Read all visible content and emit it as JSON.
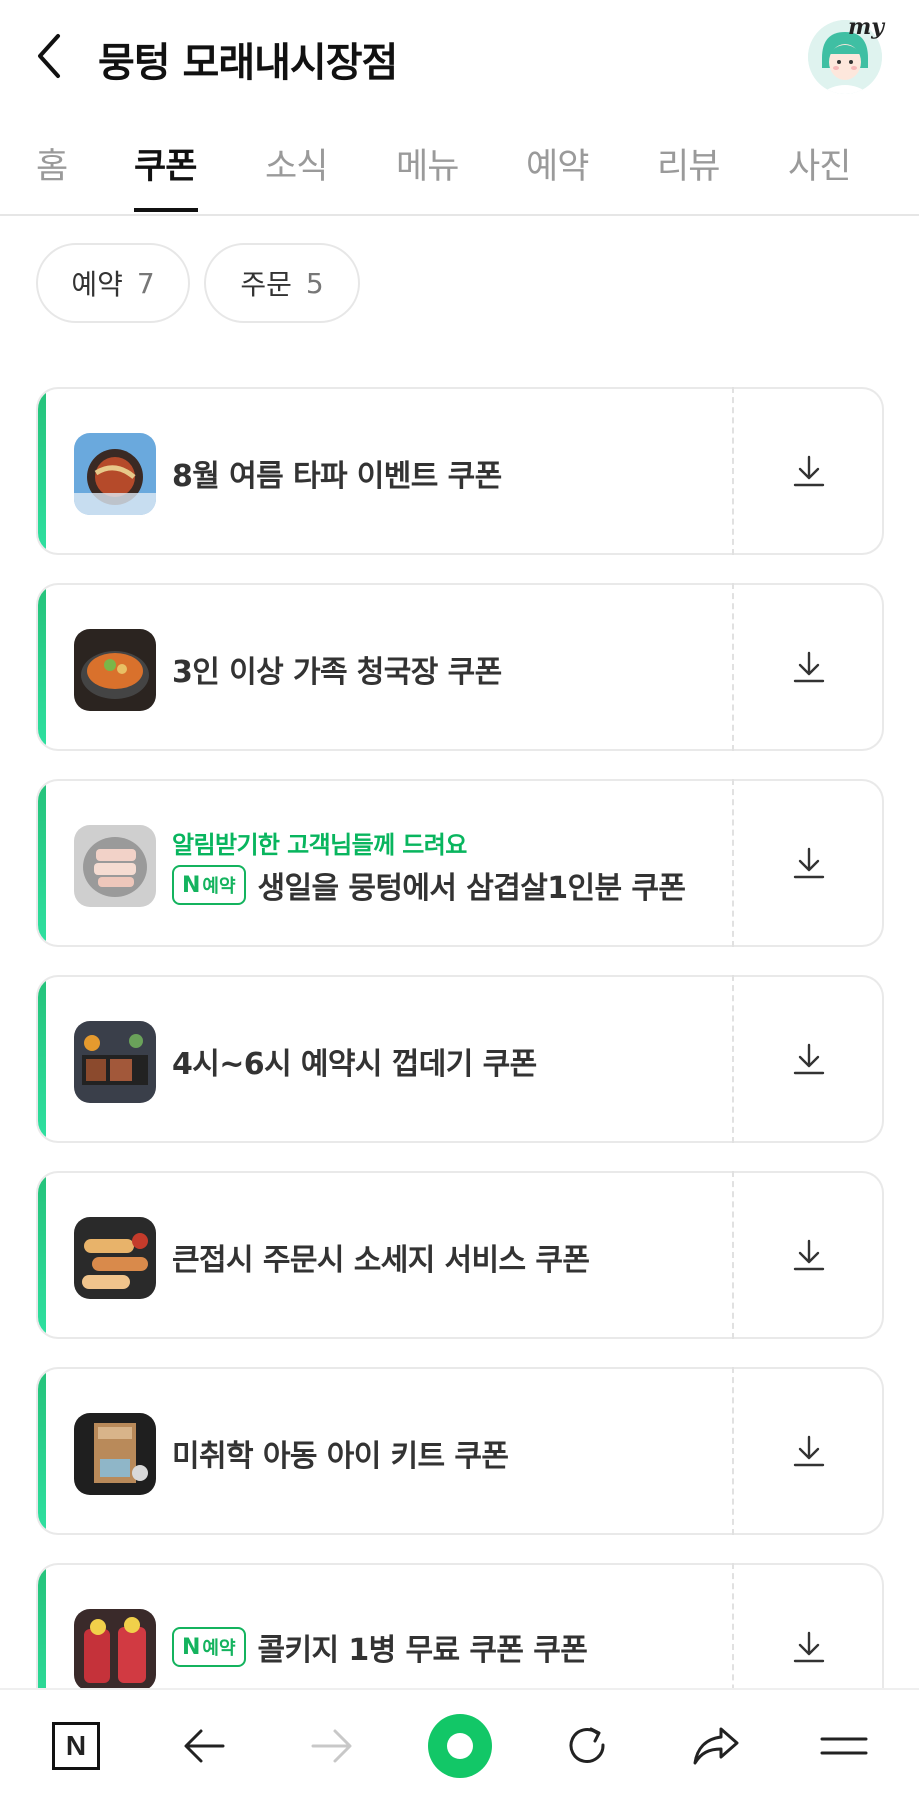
{
  "header": {
    "title": "뭉텅 모래내시장점",
    "my_badge": "my"
  },
  "tabs": [
    {
      "label": "홈"
    },
    {
      "label": "쿠폰",
      "active": true
    },
    {
      "label": "소식"
    },
    {
      "label": "메뉴"
    },
    {
      "label": "예약"
    },
    {
      "label": "리뷰"
    },
    {
      "label": "사진"
    }
  ],
  "filters": [
    {
      "label": "예약",
      "count": "7"
    },
    {
      "label": "주문",
      "count": "5"
    }
  ],
  "coupons": [
    {
      "name": "8월 여름 타파 이벤트 쿠폰"
    },
    {
      "name": "3인 이상 가족 청국장 쿠폰"
    },
    {
      "sub": "알림받기한 고객님들께 드려요",
      "badge": "예약",
      "badge_prefix": "N",
      "name": "생일을 뭉텅에서 삼겹살1인분 쿠폰"
    },
    {
      "name": "4시~6시 예약시 껍데기 쿠폰"
    },
    {
      "name": "큰접시 주문시 소세지 서비스 쿠폰"
    },
    {
      "name": "미취학 아동 아이 키트 쿠폰"
    },
    {
      "badge": "예약",
      "badge_prefix": "N",
      "name": "콜키지 1병 무료 쿠폰 쿠폰"
    }
  ],
  "bottom_nav": {
    "home_label": "N"
  },
  "colors": {
    "accent_green": "#12c767",
    "badge_green": "#14b35e",
    "sub_green": "#08b55e"
  }
}
